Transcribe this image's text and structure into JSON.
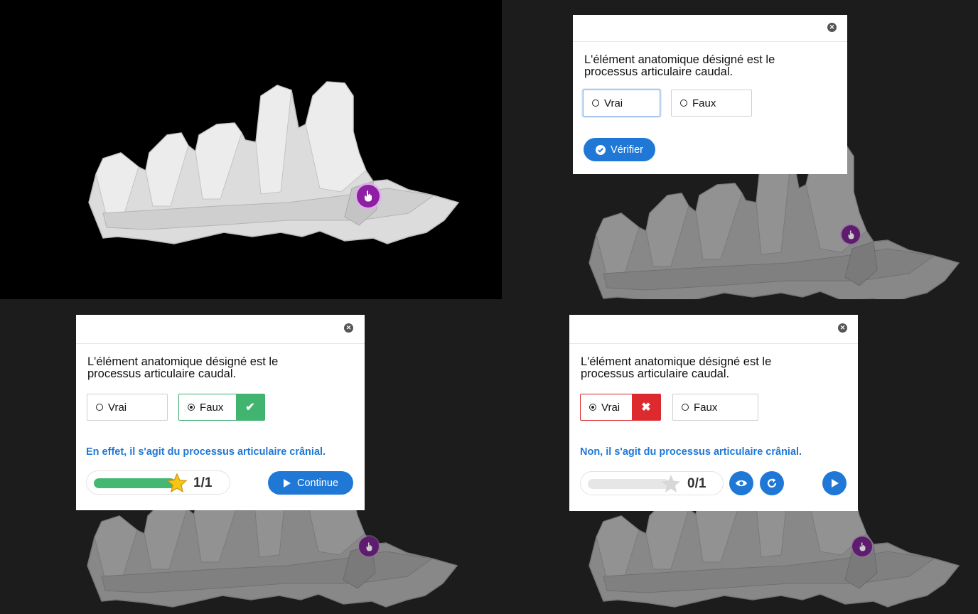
{
  "question": "L'élément anatomique désigné est le processus articulaire caudal.",
  "options": {
    "true_label": "Vrai",
    "false_label": "Faux"
  },
  "verify_label": "Vérifier",
  "continue_label": "Continue",
  "feedback_correct": "En effet, il s'agit du processus articulaire crânial.",
  "feedback_wrong": "Non, il s'agit du processus articulaire crânial.",
  "score_correct": "1/1",
  "score_wrong": "0/1",
  "progress_correct": 1.0,
  "progress_wrong": 0.0,
  "icons": {
    "close": "close-icon",
    "hotspot": "hand-pointer-icon",
    "verify": "check-circle-icon",
    "continue": "play-icon",
    "star": "star-icon",
    "show": "eye-icon",
    "retry": "retry-icon",
    "next": "play-icon"
  },
  "colors": {
    "accent": "#1f78d6",
    "correct": "#41b470",
    "wrong": "#dd2a2f",
    "hotspot": "#8e1fa3"
  }
}
